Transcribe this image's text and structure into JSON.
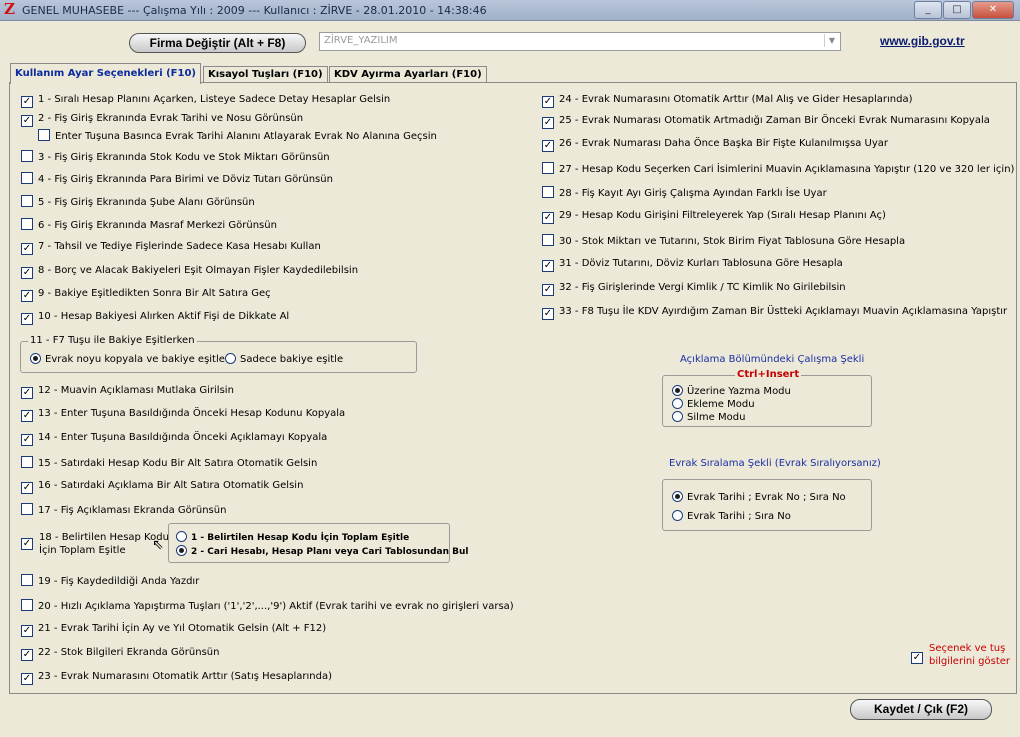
{
  "window": {
    "title": "GENEL MUHASEBE  ---  Çalışma Yılı : 2009  ---  Kullanıcı : ZİRVE - 28.01.2010 - 14:38:46",
    "logo": "Z",
    "controls": {
      "minimize": "_",
      "maximize": "□",
      "close": "✕"
    }
  },
  "header": {
    "change_company_label": "Firma Değiştir (Alt + F8)",
    "company_value": "ZİRVE_YAZILIM",
    "combo_arrow": "▼",
    "gib_link": "www.gib.gov.tr"
  },
  "tabs": [
    {
      "label": "Kullanım Ayar Seçenekleri (F10)"
    },
    {
      "label": "Kısayol Tuşları (F10)"
    },
    {
      "label": "KDV Ayırma Ayarları  (F10)"
    }
  ],
  "left_options": [
    {
      "label": "1 -  Sıralı Hesap Planını Açarken, Listeye Sadece Detay Hesaplar Gelsin",
      "checked": "✓"
    },
    {
      "label": "2 - Fiş Giriş Ekranında Evrak Tarihi ve Nosu Görünsün",
      "checked": "✓"
    },
    {
      "label": "Enter Tuşuna Basınca Evrak Tarihi Alanını Atlayarak Evrak No Alanına Geçsin",
      "checked": ""
    },
    {
      "label": "3 - Fiş Giriş Ekranında Stok Kodu ve Stok Miktarı Görünsün",
      "checked": ""
    },
    {
      "label": "4 - Fiş Giriş Ekranında Para Birimi ve Döviz Tutarı Görünsün",
      "checked": ""
    },
    {
      "label": "5 - Fiş Giriş Ekranında Şube Alanı Görünsün",
      "checked": ""
    },
    {
      "label": "6 - Fiş Giriş Ekranında Masraf Merkezi Görünsün",
      "checked": ""
    },
    {
      "label": "7 - Tahsil ve Tediye Fişlerinde Sadece Kasa Hesabı Kullan",
      "checked": "✓"
    },
    {
      "label": "8 - Borç ve Alacak Bakiyeleri Eşit Olmayan Fişler Kaydedilebilsin",
      "checked": "✓"
    },
    {
      "label": "9 - Bakiye Eşitledikten Sonra Bir Alt Satıra Geç",
      "checked": "✓"
    },
    {
      "label": "10 - Hesap Bakiyesi Alırken Aktif Fişi de Dikkate Al",
      "checked": "✓"
    }
  ],
  "group11": {
    "title": "11 - F7 Tuşu ile Bakiye  Eşitlerken",
    "option_a": "Evrak noyu kopyala ve bakiye eşitle",
    "option_b": "Sadece bakiye eşitle"
  },
  "left_options_2": [
    {
      "label": "12 - Muavin Açıklaması Mutlaka Girilsin",
      "checked": "✓"
    },
    {
      "label": "13 - Enter Tuşuna Basıldığında Önceki Hesap Kodunu Kopyala",
      "checked": "✓"
    },
    {
      "label": "14 - Enter Tuşuna Basıldığında Önceki Açıklamayı Kopyala",
      "checked": "✓"
    },
    {
      "label": "15 - Satırdaki Hesap Kodu Bir Alt Satıra Otomatik Gelsin",
      "checked": ""
    },
    {
      "label": "16 - Satırdaki Açıklama Bir Alt Satıra Otomatik Gelsin",
      "checked": "✓"
    },
    {
      "label": "17 - Fiş Açıklaması Ekranda Görünsün",
      "checked": ""
    }
  ],
  "option18": {
    "line1": "18 - Belirtilen Hesap Kodu",
    "line2": "İçin Toplam Eşitle",
    "checked": "✓",
    "radio_1": "1 - Belirtilen Hesap Kodu İçin Toplam Eşitle",
    "radio_2": "2 - Cari Hesabı, Hesap Planı veya Cari Tablosundan Bul",
    "cursor": "⇖"
  },
  "left_options_3": [
    {
      "label": "19 - Fiş Kaydedildiği Anda Yazdır",
      "checked": ""
    },
    {
      "label": "20 - Hızlı Açıklama Yapıştırma Tuşları ('1','2',...,'9') Aktif (Evrak tarihi ve evrak no girişleri varsa)",
      "checked": ""
    },
    {
      "label": "21 - Evrak Tarihi İçin Ay ve Yıl Otomatik Gelsin (Alt + F12)",
      "checked": "✓"
    },
    {
      "label": "22 - Stok Bilgileri Ekranda Görünsün",
      "checked": "✓"
    },
    {
      "label": "23 - Evrak Numarasını Otomatik Arttır (Satış Hesaplarında)",
      "checked": "✓"
    }
  ],
  "right_options": [
    {
      "label": "24 - Evrak Numarasını Otomatik Arttır (Mal Alış ve Gider Hesaplarında)",
      "checked": "✓"
    },
    {
      "label": "25 - Evrak Numarası Otomatik Artmadığı Zaman Bir Önceki Evrak Numarasını Kopyala",
      "checked": "✓"
    },
    {
      "label": "26 - Evrak Numarası Daha Önce Başka Bir Fişte Kulanılmışsa Uyar",
      "checked": "✓"
    },
    {
      "label": "27 - Hesap Kodu Seçerken Cari İsimlerini Muavin Açıklamasına Yapıştır (120 ve 320 ler için)",
      "checked": ""
    },
    {
      "label": "28 - Fiş Kayıt Ayı Giriş Çalışma Ayından Farklı İse Uyar",
      "checked": ""
    },
    {
      "label": "29 - Hesap Kodu Girişini Filtreleyerek Yap (Sıralı Hesap Planını Aç)",
      "checked": "✓"
    },
    {
      "label": "30 - Stok Miktarı ve Tutarını, Stok Birim Fiyat Tablosuna Göre Hesapla",
      "checked": ""
    },
    {
      "label": "31 - Döviz Tutarını, Döviz Kurları Tablosuna Göre Hesapla",
      "checked": "✓"
    },
    {
      "label": "32 - Fiş Girişlerinde Vergi Kimlik / TC Kimlik No Girilebilsin",
      "checked": "✓"
    },
    {
      "label": "33 - F8 Tuşu İle KDV Ayırdığım Zaman Bir Üstteki Açıklamayı Muavin Açıklamasına Yapıştır",
      "checked": "✓"
    }
  ],
  "aciklama": {
    "title": "Açıklama Bölümündeki Çalışma Şekli",
    "subtitle": "Ctrl+Insert",
    "options": [
      "Üzerine Yazma Modu",
      "Ekleme Modu",
      "Silme Modu"
    ]
  },
  "siralama": {
    "title": "Evrak Sıralama Şekli (Evrak Sıralıyorsanız)",
    "options": [
      "Evrak Tarihi ; Evrak No ; Sıra No",
      "Evrak Tarihi ; Sıra No"
    ]
  },
  "show_info": {
    "line1": "Seçenek ve tuş",
    "line2": "bilgilerini göster",
    "checked": "✓"
  },
  "footer": {
    "save_label": "Kaydet / Çık (F2)"
  },
  "colors": {
    "accent_blue": "#1a2fa5",
    "accent_red": "#c80000",
    "window_bg": "#ece9d8"
  }
}
